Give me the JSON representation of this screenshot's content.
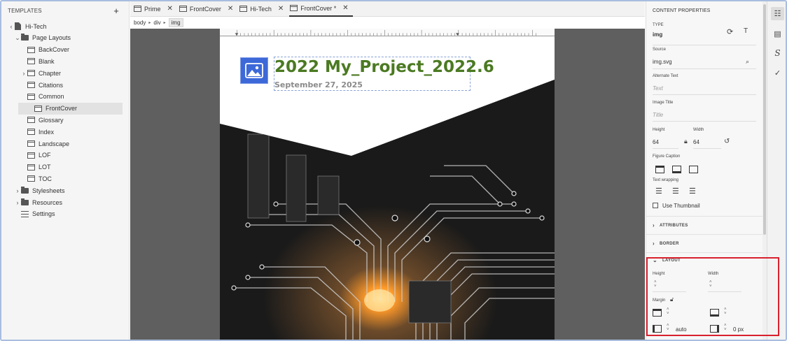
{
  "left_panel": {
    "header": "TEMPLATES",
    "add_label": "+",
    "tree": [
      {
        "label": "Hi-Tech",
        "kind": "doc",
        "chevron": "‹",
        "indent": 0
      },
      {
        "label": "Page Layouts",
        "kind": "folder",
        "chevron": "⌄",
        "indent": 1
      },
      {
        "label": "BackCover",
        "kind": "page",
        "indent": 2
      },
      {
        "label": "Blank",
        "kind": "page",
        "indent": 2
      },
      {
        "label": "Chapter",
        "kind": "page",
        "chevron": "›",
        "indent": 2
      },
      {
        "label": "Citations",
        "kind": "page",
        "indent": 2
      },
      {
        "label": "Common",
        "kind": "page",
        "indent": 2
      },
      {
        "label": "FrontCover",
        "kind": "page",
        "indent": 2,
        "selected": true
      },
      {
        "label": "Glossary",
        "kind": "page",
        "indent": 2
      },
      {
        "label": "Index",
        "kind": "page",
        "indent": 2
      },
      {
        "label": "Landscape",
        "kind": "page",
        "indent": 2
      },
      {
        "label": "LOF",
        "kind": "page",
        "indent": 2
      },
      {
        "label": "LOT",
        "kind": "page",
        "indent": 2
      },
      {
        "label": "TOC",
        "kind": "page",
        "indent": 2
      },
      {
        "label": "Stylesheets",
        "kind": "folder",
        "chevron": "›",
        "indent": 1
      },
      {
        "label": "Resources",
        "kind": "folder",
        "chevron": "›",
        "indent": 1
      },
      {
        "label": "Settings",
        "kind": "settings",
        "indent": 1
      }
    ]
  },
  "tabs": [
    {
      "label": "Prime",
      "close": "✕"
    },
    {
      "label": "FrontCover",
      "close": "✕"
    },
    {
      "label": "Hi-Tech",
      "close": "✕"
    },
    {
      "label": "FrontCover *",
      "close": "✕",
      "active": true
    }
  ],
  "breadcrumb": {
    "items": [
      "body",
      "div",
      "img"
    ],
    "sep": "▸"
  },
  "page": {
    "title": "2022 My_Project_2022.6",
    "date": "September 27, 2025",
    "image_icon": "image-icon",
    "title_color": "#4b7a22"
  },
  "content_properties": {
    "header": "CONTENT PROPERTIES",
    "type_label": "TYPE",
    "type_value": "img",
    "source_label": "Source",
    "source_value": "img.svg",
    "alt_label": "Alternate Text",
    "alt_placeholder": "Text",
    "image_title_label": "Image Title",
    "image_title_placeholder": "Title",
    "height_label": "Height",
    "height_value": "64",
    "width_label": "Width",
    "width_value": "64",
    "figure_caption_label": "Figure Caption",
    "text_wrapping_label": "Text wrapping",
    "use_thumbnail_label": "Use Thumbnail",
    "attributes_label": "ATTRIBUTES",
    "border_label": "BORDER",
    "layout_label": "LAYOUT",
    "layout_height_label": "Height",
    "layout_width_label": "Width",
    "margin_label": "Margin",
    "margin_left_value": "auto",
    "margin_right_value": "0 px",
    "highlight_color": "#d9202e"
  }
}
